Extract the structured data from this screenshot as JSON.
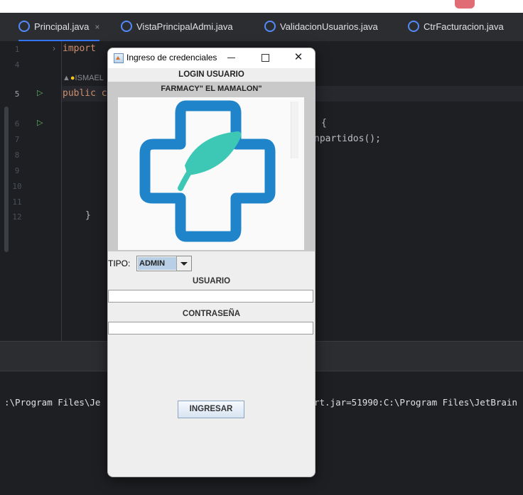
{
  "ide": {
    "tabs": [
      {
        "label": "Principal.java",
        "close": "×"
      },
      {
        "label": "VistaPrincipalAdmi.java"
      },
      {
        "label": "ValidacionUsuarios.java"
      },
      {
        "label": "CtrFacturacion.java"
      }
    ],
    "line_numbers": [
      "1",
      "4",
      "5",
      "6",
      "7",
      "8",
      "9",
      "10",
      "11",
      "12"
    ],
    "code": {
      "import_kw": "import",
      "author": "ISMAEL",
      "public_kw": "public c",
      "brace_open": "{",
      "call_fragment": "npartidos();",
      "brace_close": "}"
    },
    "console": {
      "line_left": ":\\Program Files\\Je",
      "line_right": "rt.jar=51990:C:\\Program Files\\JetBrain"
    }
  },
  "dialog": {
    "title": "Ingreso de credenciales",
    "minimize_symbol": "—",
    "close_symbol": "✕",
    "header": "LOGIN USUARIO",
    "subheader": "FARMACY\" EL MAMALON\"",
    "tipo_label": "TIPO:",
    "tipo_value": "ADMIN",
    "usuario_label": "USUARIO",
    "usuario_value": "",
    "password_label": "CONTRASEÑA",
    "password_value": "",
    "submit_label": "INGRESAR",
    "colors": {
      "logo_blue": "#1f84c9",
      "logo_teal": "#3cc8b4"
    }
  }
}
